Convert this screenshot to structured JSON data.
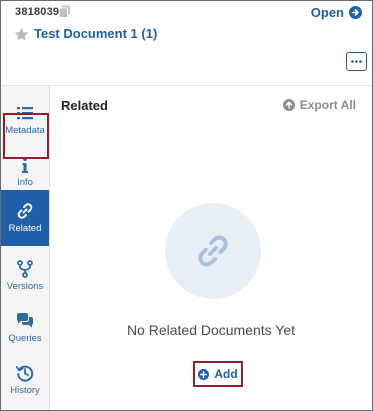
{
  "header": {
    "doc_id": "3818039",
    "open_label": "Open",
    "title": "Test Document 1 (1)"
  },
  "sidebar": {
    "items": [
      {
        "label": "Metadata",
        "icon": "list-icon"
      },
      {
        "label": "Info",
        "icon": "info-icon"
      },
      {
        "label": "Related",
        "icon": "link-icon",
        "active": true
      },
      {
        "label": "Versions",
        "icon": "branch-icon"
      },
      {
        "label": "Queries",
        "icon": "chat-bubbles-icon"
      },
      {
        "label": "History",
        "icon": "history-icon"
      }
    ]
  },
  "main": {
    "title": "Related",
    "export_label": "Export All",
    "empty_message": "No Related Documents Yet",
    "add_label": "Add"
  },
  "colors": {
    "accent": "#1f5ea8",
    "highlight_outline": "#9a1c2a",
    "muted": "#8c8c8c",
    "empty_circle": "#e8eff7"
  }
}
